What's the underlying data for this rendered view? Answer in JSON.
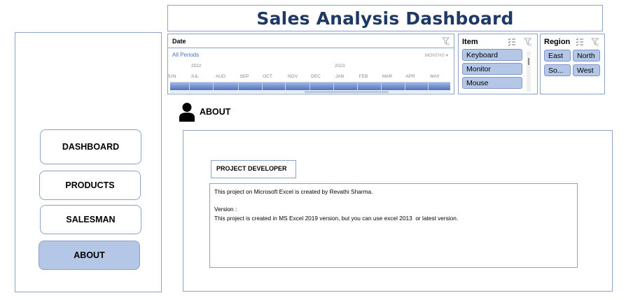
{
  "title": "Sales Analysis Dashboard",
  "nav": {
    "items": [
      {
        "label": "DASHBOARD",
        "active": false
      },
      {
        "label": "PRODUCTS",
        "active": false
      },
      {
        "label": "SALESMAN",
        "active": false
      },
      {
        "label": "ABOUT",
        "active": true
      }
    ]
  },
  "timeline": {
    "label": "Date",
    "period_text": "All Periods",
    "level": "MONTHS",
    "years": [
      "2022",
      "2023"
    ],
    "months": [
      "JUN",
      "JUL",
      "AUG",
      "SEP",
      "OCT",
      "NOV",
      "DEC",
      "JAN",
      "FEB",
      "MAR",
      "APR",
      "MAY"
    ]
  },
  "item_slicer": {
    "header": "Item",
    "items": [
      "Keyboard",
      "Monitor",
      "Mouse"
    ]
  },
  "region_slicer": {
    "header": "Region",
    "items": [
      "East",
      "North",
      "So...",
      "West"
    ]
  },
  "about": {
    "header": "ABOUT",
    "developer_label": "PROJECT DEVELOPER",
    "line1": "This project on Microsoft Excel is created by Revathi Sharma.",
    "version_label": "Version :",
    "version_text": "This project is created in MS Excel 2019 version, but you can use excel 2013  or latest version."
  },
  "colors": {
    "title": "#1f3864",
    "border": "#8fa3c8",
    "active_fill": "#b4c7e7",
    "timeline_bar": "#4f73c0",
    "link": "#4472c4"
  }
}
